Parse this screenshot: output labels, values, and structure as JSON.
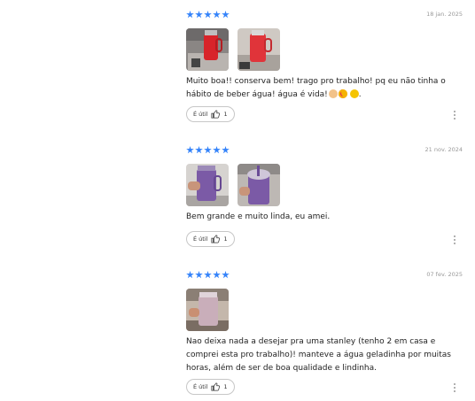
{
  "colors": {
    "star": "#3483fa",
    "text": "#222222",
    "muted": "#999999",
    "border": "#c7c7c7"
  },
  "icons": {
    "helpful": "thumbs-up-icon",
    "more": "more-vertical-icon",
    "rating": "star-icon"
  },
  "reviews": [
    {
      "rating": 5,
      "date": "18 jan. 2025",
      "photo_count": 2,
      "text": "Muito boa!! conserva bem! trago pro trabalho! pq eu não tinha o hábito de beber água! água é vida!",
      "emojis": [
        "clapping-hands-emoji",
        "heart-eyes-emoji",
        "grinning-emoji"
      ],
      "emoji_trailing": ".",
      "helpful_label": "É útil",
      "helpful_count": "1"
    },
    {
      "rating": 5,
      "date": "21 nov. 2024",
      "photo_count": 2,
      "text": "Bem grande e muito linda, eu amei.",
      "helpful_label": "É útil",
      "helpful_count": "1"
    },
    {
      "rating": 5,
      "date": "07 fev. 2025",
      "photo_count": 1,
      "text": "Nao deixa nada a desejar pra uma stanley (tenho 2 em casa e comprei esta pro trabalho)! manteve a água geladinha por muitas horas, além de ser de boa qualidade e lindinha.",
      "helpful_label": "É útil",
      "helpful_count": "1"
    }
  ]
}
